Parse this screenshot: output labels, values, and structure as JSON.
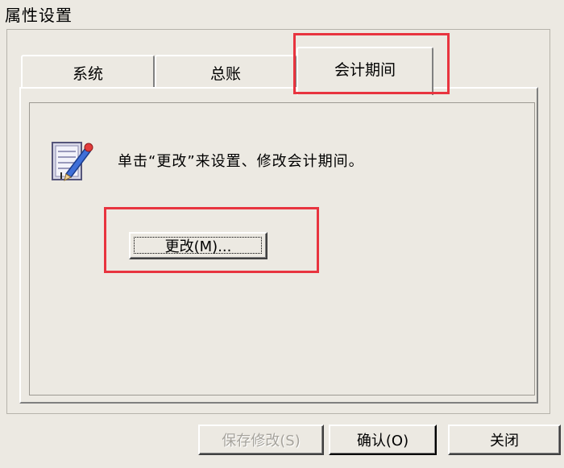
{
  "window": {
    "title": "属性设置"
  },
  "tabs": [
    {
      "label": "系统",
      "active": false
    },
    {
      "label": "总账",
      "active": false
    },
    {
      "label": "会计期间",
      "active": true
    }
  ],
  "panel": {
    "instruction": "单击“更改”来设置、修改会计期间。",
    "change_button": "更改(M)..."
  },
  "footer": {
    "save_button": "保存修改(S)",
    "ok_button": "确认(O)",
    "close_button": "关闭"
  },
  "colors": {
    "highlight": "#e8343f",
    "dialog_bg": "#ece9e2"
  },
  "icons": {
    "period": "edit-pencil-icon"
  }
}
